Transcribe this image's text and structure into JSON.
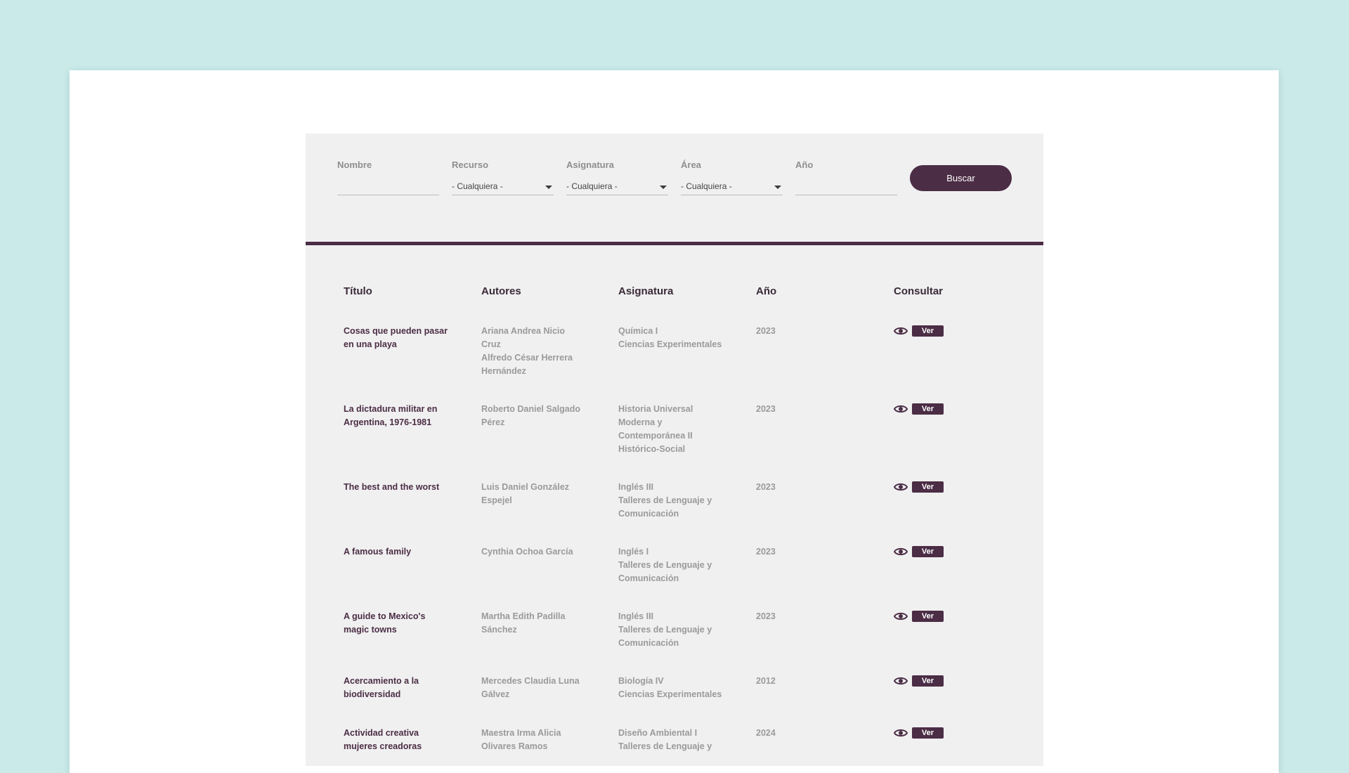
{
  "filters": {
    "nombre_label": "Nombre",
    "nombre_value": "",
    "recurso_label": "Recurso",
    "recurso_value": "- Cualquiera -",
    "asignatura_label": "Asignatura",
    "asignatura_value": "- Cualquiera -",
    "area_label": "Área",
    "area_value": "- Cualquiera -",
    "anio_label": "Año",
    "anio_value": "",
    "search_button": "Buscar"
  },
  "table": {
    "headers": {
      "title": "Título",
      "authors": "Autores",
      "subject": "Asignatura",
      "year": "Año",
      "action": "Consultar"
    },
    "action_label": "Ver",
    "rows": [
      {
        "title": [
          "Cosas que pueden pasar",
          "en una playa"
        ],
        "authors": [
          "Ariana Andrea Nicio",
          "Cruz",
          "Alfredo César Herrera",
          "Hernández"
        ],
        "subject": [
          "Química I",
          "Ciencias Experimentales"
        ],
        "year": "2023"
      },
      {
        "title": [
          "La dictadura militar en",
          "Argentina, 1976-1981"
        ],
        "authors": [
          "Roberto Daniel Salgado",
          "Pérez"
        ],
        "subject": [
          "Historia Universal",
          "Moderna y",
          "Contemporánea II",
          "Histórico-Social"
        ],
        "year": "2023"
      },
      {
        "title": [
          "The best and the worst"
        ],
        "authors": [
          "Luis Daniel González",
          "Espejel"
        ],
        "subject": [
          "Inglés III",
          "Talleres de Lenguaje y",
          "Comunicación"
        ],
        "year": "2023"
      },
      {
        "title": [
          "A famous family"
        ],
        "authors": [
          "Cynthia Ochoa García"
        ],
        "subject": [
          "Inglés I",
          "Talleres de Lenguaje y",
          "Comunicación"
        ],
        "year": "2023"
      },
      {
        "title": [
          "A guide to Mexico's",
          "magic towns"
        ],
        "authors": [
          "Martha Edith Padilla",
          "Sánchez"
        ],
        "subject": [
          "Inglés III",
          "Talleres de Lenguaje y",
          "Comunicación"
        ],
        "year": "2023"
      },
      {
        "title": [
          "Acercamiento a la",
          "biodiversidad"
        ],
        "authors": [
          "Mercedes Claudia Luna",
          "Gálvez"
        ],
        "subject": [
          "Biología IV",
          "Ciencias Experimentales"
        ],
        "year": "2012"
      },
      {
        "title": [
          "Actividad creativa",
          "mujeres creadoras"
        ],
        "authors": [
          "Maestra Irma Alicia",
          "Olivares Ramos"
        ],
        "subject": [
          "Diseño Ambiental I",
          "Talleres de Lenguaje y"
        ],
        "year": "2024"
      }
    ]
  }
}
